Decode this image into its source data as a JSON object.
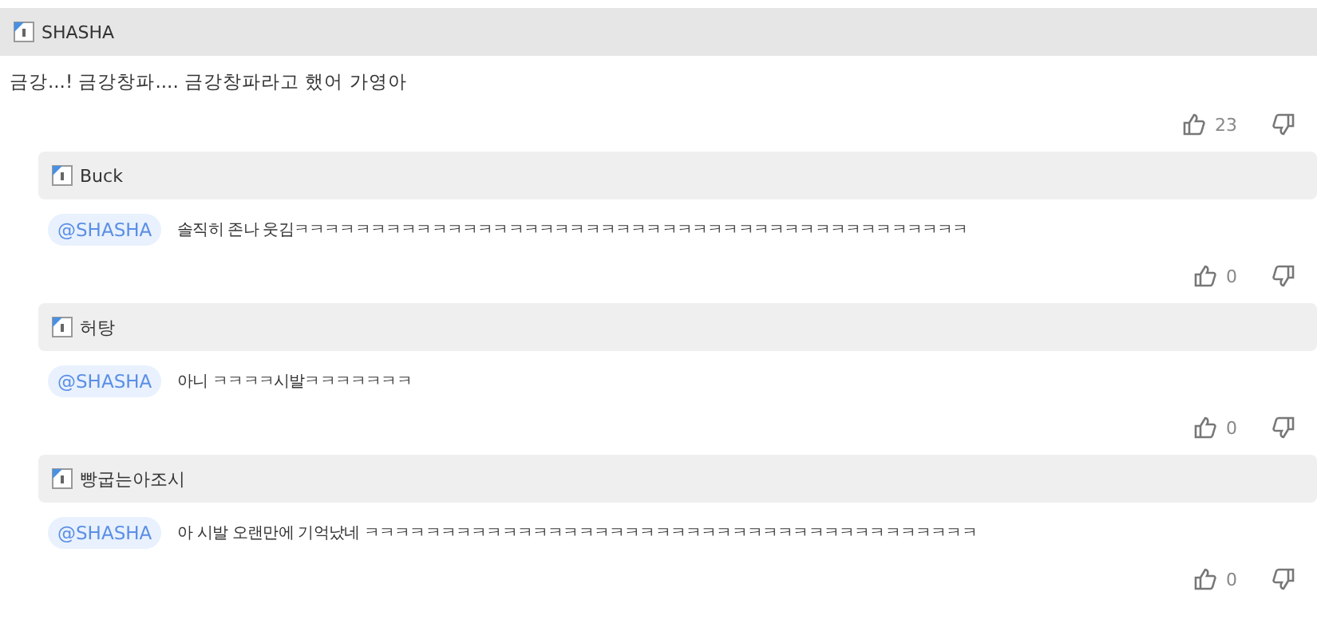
{
  "comment": {
    "author": "SHASHA",
    "text": "금강...! 금강창파.... 금강창파라고 했어 가영아",
    "likes": "23"
  },
  "replies": [
    {
      "author": "Buck",
      "mention": "@SHASHA",
      "text": "솔직히 존나 웃김ㅋㅋㅋㅋㅋㅋㅋㅋㅋㅋㅋㅋㅋㅋㅋㅋㅋㅋㅋㅋㅋㅋㅋㅋㅋㅋㅋㅋㅋㅋㅋㅋㅋㅋㅋㅋㅋㅋㅋㅋㅋㅋㅋㅋ",
      "likes": "0"
    },
    {
      "author": "허탕",
      "mention": "@SHASHA",
      "text": "아니 ㅋㅋㅋㅋ시발ㅋㅋㅋㅋㅋㅋㅋ",
      "likes": "0"
    },
    {
      "author": "빵굽는아조시",
      "mention": "@SHASHA",
      "text": "아 시발 오랜만에 기억났네 ㅋㅋㅋㅋㅋㅋㅋㅋㅋㅋㅋㅋㅋㅋㅋㅋㅋㅋㅋㅋㅋㅋㅋㅋㅋㅋㅋㅋㅋㅋㅋㅋㅋㅋㅋㅋㅋㅋㅋㅋ",
      "likes": "0"
    }
  ]
}
